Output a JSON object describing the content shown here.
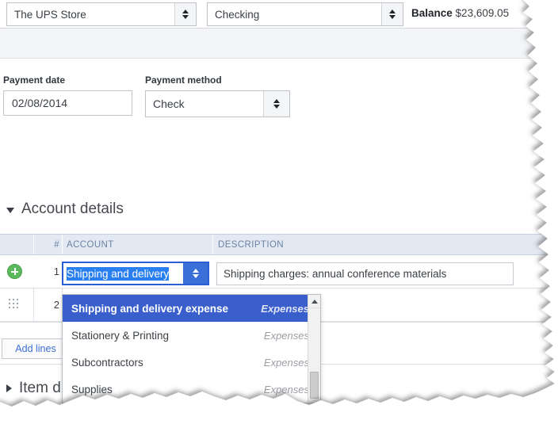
{
  "header": {
    "vendor": {
      "value": "The UPS Store",
      "icon": "spinner-updown-icon"
    },
    "bank_account": {
      "value": "Checking",
      "icon": "spinner-updown-icon"
    },
    "balance_label": "Balance",
    "balance_value": "$23,609.05"
  },
  "form": {
    "payment_date_label": "Payment date",
    "payment_date_value": "02/08/2014",
    "payment_method_label": "Payment method",
    "payment_method_value": "Check"
  },
  "account_details": {
    "section_title": "Account details",
    "caret": "caret-down-icon",
    "columns": {
      "num": "#",
      "account": "ACCOUNT",
      "description": "DESCRIPTION"
    },
    "rows": [
      {
        "num": "1",
        "row_icon": "add-row-icon",
        "account_value": "Shipping and delivery",
        "description": "Shipping charges: annual conference materials"
      },
      {
        "num": "2",
        "row_icon": "drag-handle-icon",
        "account_value": "",
        "description": ""
      }
    ],
    "add_lines_label": "Add lines"
  },
  "dropdown": {
    "options": [
      {
        "label": "Shipping and delivery expense",
        "type": "Expenses",
        "selected": true
      },
      {
        "label": "Stationery & Printing",
        "type": "Expenses",
        "selected": false
      },
      {
        "label": "Subcontractors",
        "type": "Expenses",
        "selected": false
      },
      {
        "label": "Supplies",
        "type": "Expenses",
        "selected": false
      }
    ],
    "scroll_up_icon": "scroll-up-arrow-icon"
  },
  "item_details": {
    "title": "Item d",
    "caret": "caret-right-icon"
  },
  "colors": {
    "accent_blue": "#3a5fcd",
    "focus_blue": "#2a5fd4",
    "selection_blue": "#2a7ff0",
    "link_blue": "#3a6fd8",
    "header_bg": "#e3e9f2",
    "header_text": "#6b82a3",
    "add_green": "#5cb85c",
    "band_gray": "#f4f5f8"
  }
}
